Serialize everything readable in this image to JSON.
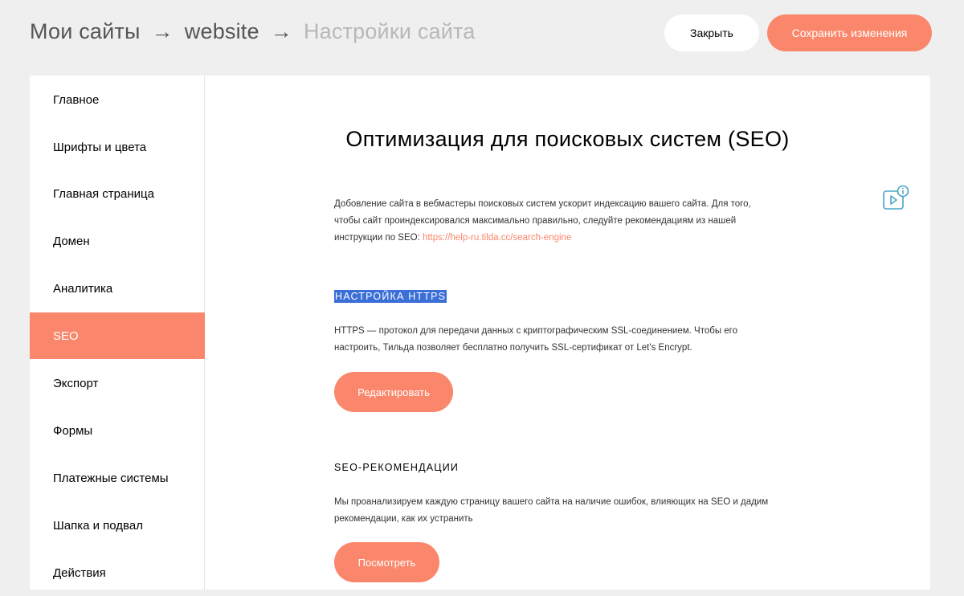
{
  "breadcrumb": {
    "items": [
      "Мои сайты",
      "website",
      "Настройки сайта"
    ],
    "separator": "→"
  },
  "header": {
    "close_label": "Закрыть",
    "save_label": "Сохранить изменения"
  },
  "sidebar": {
    "items": [
      {
        "label": "Главное"
      },
      {
        "label": "Шрифты и цвета"
      },
      {
        "label": "Главная страница"
      },
      {
        "label": "Домен"
      },
      {
        "label": "Аналитика"
      },
      {
        "label": "SEO",
        "active": true
      },
      {
        "label": "Экспорт"
      },
      {
        "label": "Формы"
      },
      {
        "label": "Платежные системы"
      },
      {
        "label": "Шапка и подвал"
      },
      {
        "label": "Действия"
      }
    ]
  },
  "main": {
    "title": "Оптимизация для поисковых систем (SEO)",
    "intro": {
      "line1": "Добовление сайта в вебмастеры поисковых систем ускорит индексацию вашего сайта. Для того,",
      "line2": "чтобы сайт проиндексировался максимально правильно, следуйте рекомендациям из нашей",
      "line3_prefix": "инструкции по SEO: ",
      "link": "https://help-ru.tilda.cc/search-engine"
    },
    "https": {
      "heading": "НАСТРОЙКА HTTPS",
      "line1": "HTTPS — протокол для передачи данных с криптографическим SSL-соединением. Чтобы его",
      "line2": "настроить, Тильда позволяет бесплатно получить SSL-сертификат от Let's Encrypt.",
      "button": "Редактировать"
    },
    "seo_recs": {
      "heading": "SEO-РЕКОМЕНДАЦИИ",
      "line1": "Мы проанализируем каждую страницу вашего сайта на наличие ошибок, влияющих на SEO и дадим",
      "line2": "рекомендации, как их устранить",
      "button": "Посмотреть"
    },
    "help_icon": "video-info-icon"
  },
  "colors": {
    "accent": "#fa876b",
    "background": "#efefef",
    "icon": "#4aa3c8",
    "selection": "#3a6fd8"
  }
}
